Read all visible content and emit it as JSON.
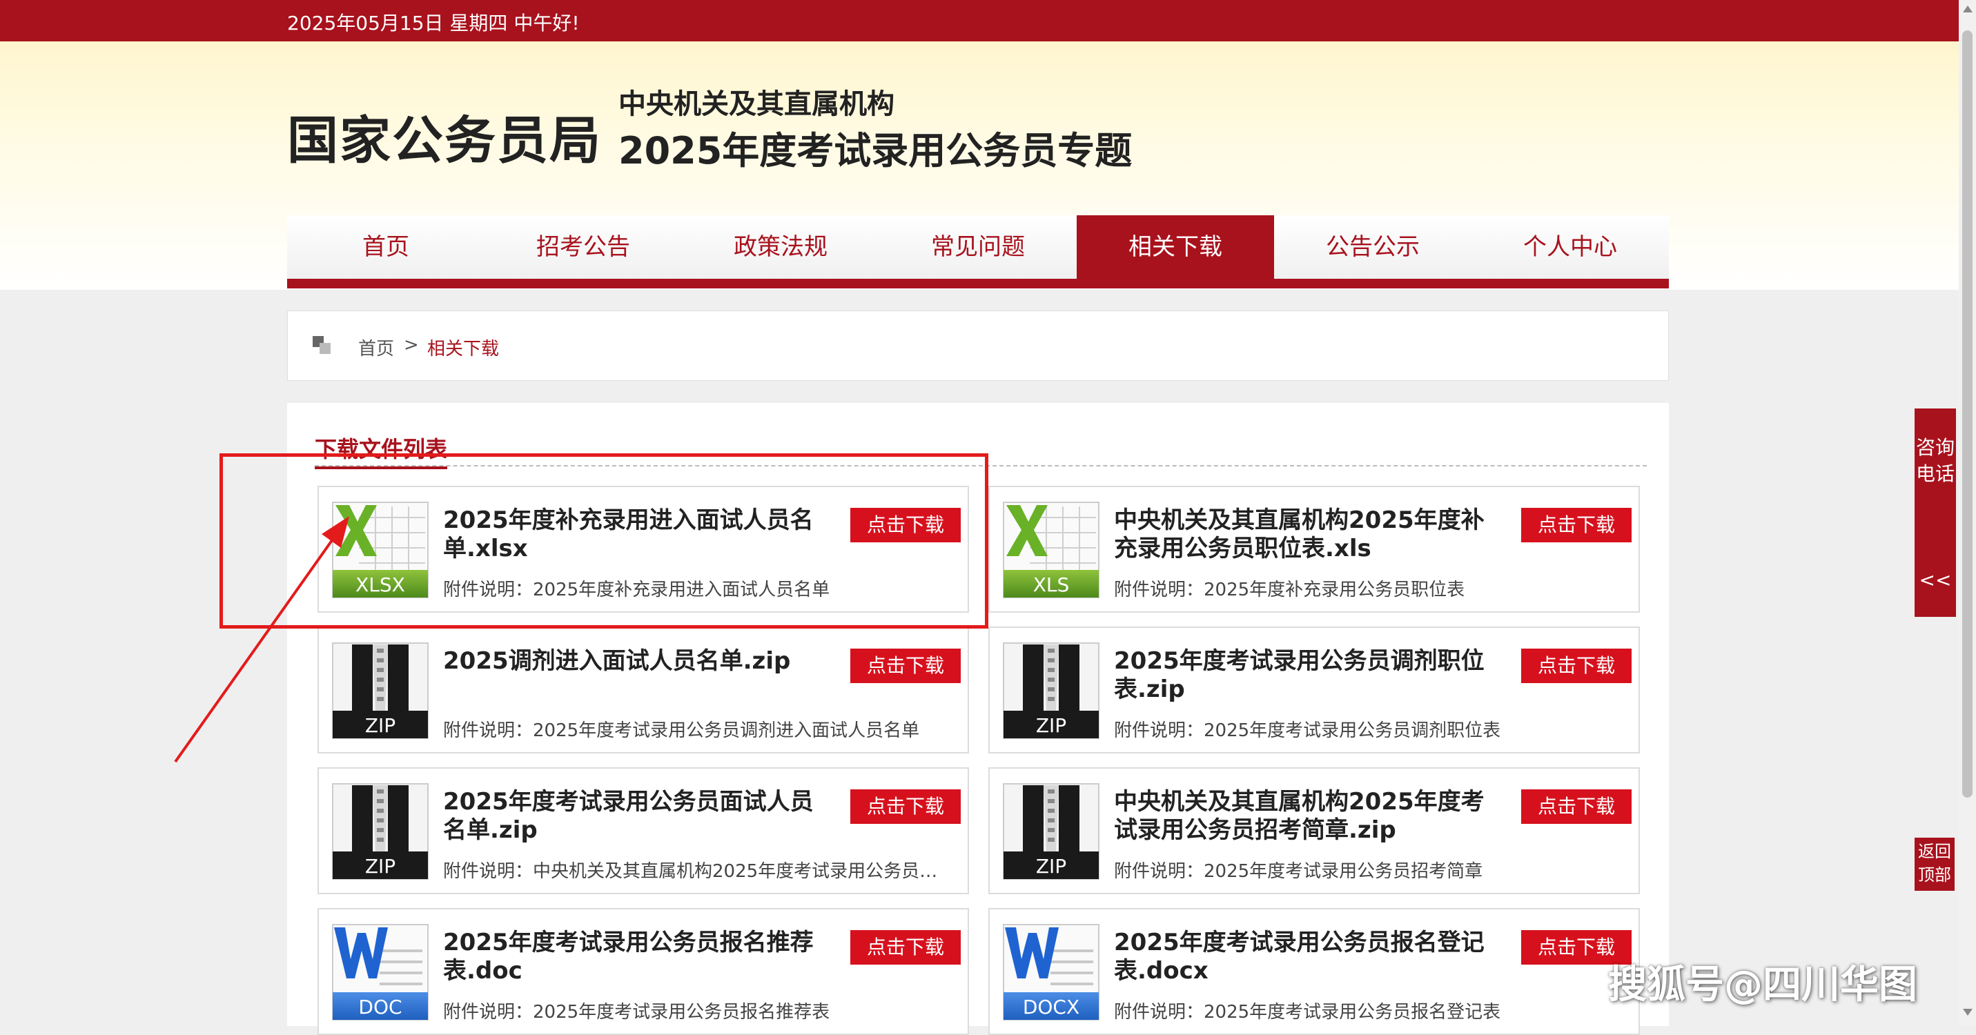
{
  "topbar": {
    "date_text": "2025年05月15日  星期四  中午好!"
  },
  "header": {
    "logo": "国家公务员局",
    "subtitle_1": "中央机关及其直属机构",
    "subtitle_2": "2025年度考试录用公务员专题"
  },
  "nav": {
    "items": [
      {
        "label": "首页"
      },
      {
        "label": "招考公告"
      },
      {
        "label": "政策法规"
      },
      {
        "label": "常见问题"
      },
      {
        "label": "相关下载"
      },
      {
        "label": "公告公示"
      },
      {
        "label": "个人中心"
      }
    ],
    "active": "相关下载"
  },
  "breadcrumb": {
    "home": "首页",
    "separator": ">",
    "current": "相关下载"
  },
  "content": {
    "section_title": "下载文件列表",
    "files": [
      {
        "title": "2025年度补充录用进入面试人员名单.xlsx",
        "desc": "附件说明：2025年度补充录用进入面试人员名单",
        "type": "XLSX",
        "button": "点击下载"
      },
      {
        "title": "中央机关及其直属机构2025年度补充录用公务员职位表.xls",
        "desc": "附件说明：2025年度补充录用公务员职位表",
        "type": "XLS",
        "button": "点击下载"
      },
      {
        "title": "2025调剂进入面试人员名单.zip",
        "desc": "附件说明：2025年度考试录用公务员调剂进入面试人员名单",
        "type": "ZIP",
        "button": "点击下载"
      },
      {
        "title": "2025年度考试录用公务员调剂职位表.zip",
        "desc": "附件说明：2025年度考试录用公务员调剂职位表",
        "type": "ZIP",
        "button": "点击下载"
      },
      {
        "title": "2025年度考试录用公务员面试人员名单.zip",
        "desc": "附件说明：中央机关及其直属机构2025年度考试录用公务员面...",
        "type": "ZIP",
        "button": "点击下载"
      },
      {
        "title": "中央机关及其直属机构2025年度考试录用公务员招考简章.zip",
        "desc": "附件说明：2025年度考试录用公务员招考简章",
        "type": "ZIP",
        "button": "点击下载"
      },
      {
        "title": "2025年度考试录用公务员报名推荐表.doc",
        "desc": "附件说明：2025年度考试录用公务员报名推荐表",
        "type": "DOC",
        "button": "点击下载"
      },
      {
        "title": "2025年度考试录用公务员报名登记表.docx",
        "desc": "附件说明：2025年度考试录用公务员报名登记表",
        "type": "DOCX",
        "button": "点击下载"
      }
    ]
  },
  "side": {
    "consult_label": "咨询电话",
    "collapse": "<<",
    "back_top": "返回顶部"
  },
  "watermark": "搜狐号@四川华图",
  "colors": {
    "brand_red": "#a8121d",
    "button_red": "#d6111d",
    "annotation_red": "#e31b1b"
  },
  "icons": {
    "xlsx": "excel-file-icon",
    "xls": "excel-file-icon",
    "zip": "zip-file-icon",
    "doc": "word-file-icon",
    "docx": "word-file-icon",
    "breadcrumb": "home-squares-icon"
  }
}
